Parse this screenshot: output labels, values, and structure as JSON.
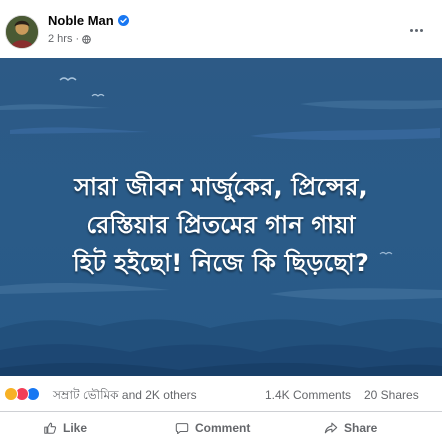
{
  "post": {
    "author": "Noble Man",
    "time": "2 hrs",
    "visibility_icon": "globe-icon",
    "verified_icon": "verified-badge-icon"
  },
  "image": {
    "lines": [
      "সারা জীবন মার্জুকের, প্রিন্সের,",
      "রেস্তিয়ার প্রিতমের গান গায়া",
      "হিট হইছো! নিজে কি ছিড়ছো?"
    ],
    "background_color": "#2b5b88",
    "text_color": "#ffffff"
  },
  "stats": {
    "reactions_text": "সম্রাট ভৌমিক and 2K others",
    "comments": "1.4K Comments",
    "shares": "20 Shares"
  },
  "actions": {
    "like": "Like",
    "comment": "Comment",
    "share": "Share"
  },
  "colors": {
    "brand_blue": "#1877f2",
    "secondary_text": "#65676b"
  }
}
